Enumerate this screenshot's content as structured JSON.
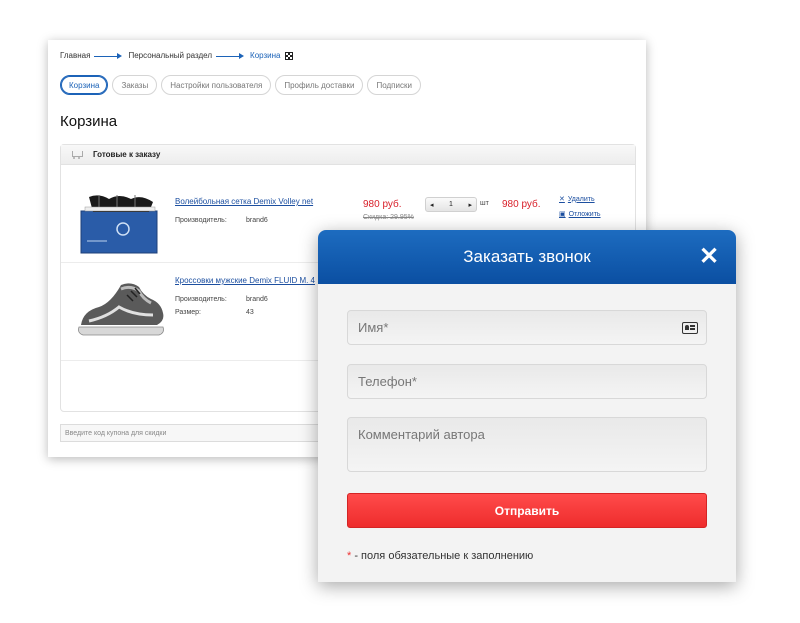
{
  "breadcrumb": {
    "items": [
      "Главная",
      "Персональный раздел",
      "Корзина"
    ]
  },
  "tabs": [
    {
      "label": "Корзина",
      "active": true
    },
    {
      "label": "Заказы",
      "active": false
    },
    {
      "label": "Настройки пользователя",
      "active": false
    },
    {
      "label": "Профиль доставки",
      "active": false
    },
    {
      "label": "Подписки",
      "active": false
    }
  ],
  "page_title": "Корзина",
  "cart": {
    "header": "Готовые к заказу",
    "items": [
      {
        "name": "Волейбольная сетка Demix Volley net",
        "props": [
          {
            "label": "Производитель:",
            "value": "brand6"
          }
        ],
        "price": "980 руб.",
        "old_price": "Скидка: 29.95%",
        "qty": "1",
        "unit": "шт",
        "total": "980 руб.",
        "actions": {
          "delete": "Удалить",
          "postpone": "Отложить"
        }
      },
      {
        "name": "Кроссовки мужские Demix FLUID M. 4",
        "props": [
          {
            "label": "Производитель:",
            "value": "brand6"
          },
          {
            "label": "Размер:",
            "value": "43"
          }
        ]
      }
    ],
    "coupon_placeholder": "Введите код купона для скидки"
  },
  "modal": {
    "title": "Заказать звонок",
    "fields": {
      "name": "Имя*",
      "phone": "Телефон*",
      "comment": "Комментарий автора"
    },
    "submit": "Отправить",
    "required_star": "*",
    "required_note": " - поля обязательные к заполнению"
  },
  "colors": {
    "accent": "#1c63b8",
    "price": "#d8202a",
    "submit": "#f43a3a",
    "modal_header": "#0f5aad"
  }
}
